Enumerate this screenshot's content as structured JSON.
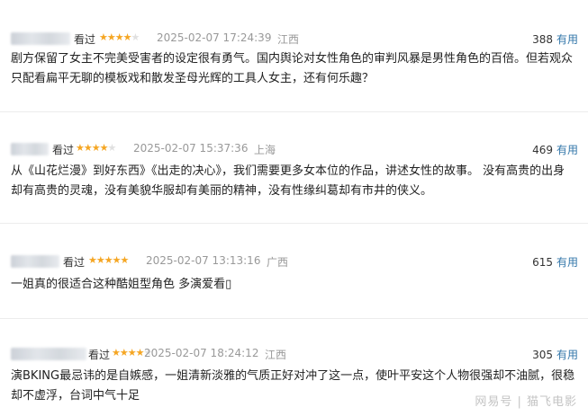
{
  "reviews": [
    {
      "status": "看过",
      "rating": 4,
      "time": "2025-02-07 17:24:39",
      "location": "江西",
      "votes": "388",
      "useful_label": "有用",
      "content": "剧方保留了女主不完美受害者的设定很有勇气。国内舆论对女性角色的审判风暴是男性角色的百倍。但若观众只配看扁平无聊的模板戏和散发圣母光辉的工具人女主，还有何乐趣？"
    },
    {
      "status": "看过",
      "rating": 4,
      "time": "2025-02-07 15:37:36",
      "location": "上海",
      "votes": "469",
      "useful_label": "有用",
      "content": "从《山花烂漫》到好东西》《出走的决心》，我们需要更多女本位的作品，讲述女性的故事。 没有高贵的出身却有高贵的灵魂，没有美貌华服却有美丽的精神，没有性缘纠葛却有市井的侠义。"
    },
    {
      "status": "看过",
      "rating": 5,
      "time": "2025-02-07 13:13:16",
      "location": "广西",
      "votes": "615",
      "useful_label": "有用",
      "content": "一姐真的很适合这种酷姐型角色 多演爱看▯"
    },
    {
      "status": "看过",
      "rating": 4,
      "time": "2025-02-07 18:24:12",
      "location": "江西",
      "votes": "305",
      "useful_label": "有用",
      "content": "演BKING最忌讳的是自嫉感，一姐清新淡雅的气质正好对冲了这一点，使叶平安这个人物很强却不油腻，很稳却不虚浮，台词中气十足"
    }
  ],
  "watermark": "网易号 | 猫飞电影"
}
